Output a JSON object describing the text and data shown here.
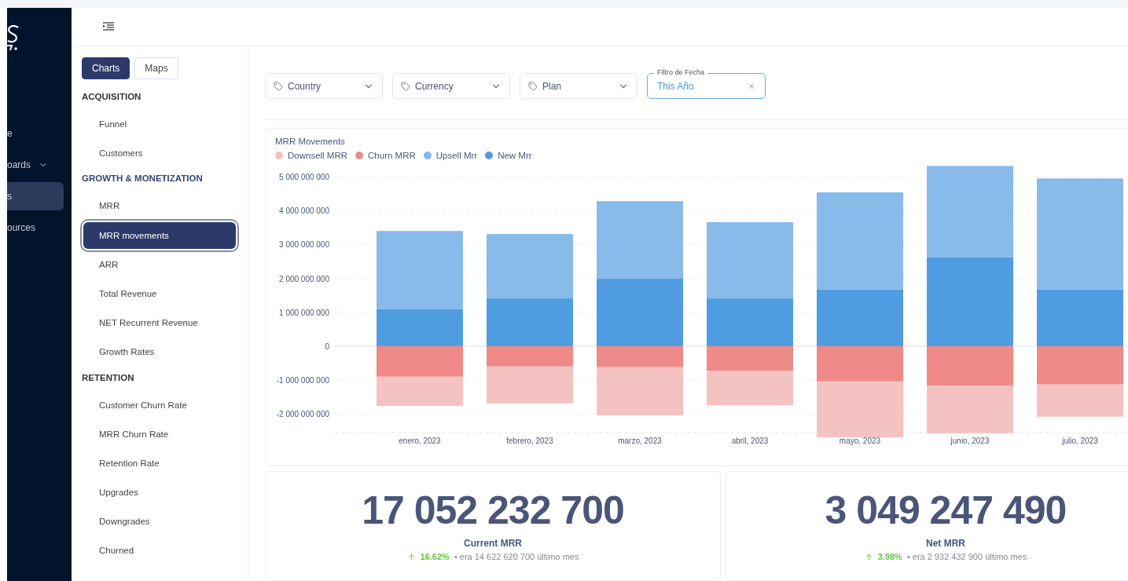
{
  "sidebar": {
    "items": [
      {
        "label": "e",
        "selected": false,
        "expandable": false
      },
      {
        "label": "oards",
        "selected": false,
        "expandable": true
      },
      {
        "label": "s",
        "selected": true,
        "expandable": false
      },
      {
        "label": "ources",
        "selected": false,
        "expandable": false
      }
    ]
  },
  "nav": {
    "tabs": [
      {
        "label": "Charts",
        "selected": true
      },
      {
        "label": "Maps",
        "selected": false
      }
    ],
    "sections": [
      {
        "title": "ACQUISITION",
        "active": false,
        "items": [
          {
            "label": "Funnel",
            "selected": false
          },
          {
            "label": "Customers",
            "selected": false
          }
        ]
      },
      {
        "title": "GROWTH & MONETIZATION",
        "active": true,
        "items": [
          {
            "label": "MRR",
            "selected": false
          },
          {
            "label": "MRR movements",
            "selected": true
          },
          {
            "label": "ARR",
            "selected": false
          },
          {
            "label": "Total Revenue",
            "selected": false
          },
          {
            "label": "NET Recurrent Revenue",
            "selected": false
          },
          {
            "label": "Growth Rates",
            "selected": false
          }
        ]
      },
      {
        "title": "RETENTION",
        "active": false,
        "items": [
          {
            "label": "Customer Churn Rate",
            "selected": false
          },
          {
            "label": "MRR Churn Rate",
            "selected": false
          },
          {
            "label": "Retention Rate",
            "selected": false
          },
          {
            "label": "Upgrades",
            "selected": false
          },
          {
            "label": "Downgrades",
            "selected": false
          },
          {
            "label": "Churned",
            "selected": false
          }
        ]
      }
    ]
  },
  "filters": [
    {
      "kind": "select",
      "label": "Country"
    },
    {
      "kind": "select",
      "label": "Currency"
    },
    {
      "kind": "select",
      "label": "Plan"
    },
    {
      "kind": "date",
      "legend": "Filtro de Fecha",
      "value": "This Año"
    }
  ],
  "chart": {
    "chart_data": {
      "type": "bar",
      "title": "MRR Movements",
      "stacked": true,
      "grid": true,
      "categories": [
        "enero, 2023",
        "febrero, 2023",
        "marzo, 2023",
        "abril, 2023",
        "mayo, 2023",
        "junio, 2023",
        "julio, 2023"
      ],
      "series": [
        {
          "name": "Downsell MRR",
          "color": "#f5c2c2",
          "values": [
            -860000000,
            -1090000000,
            -1420000000,
            -1020000000,
            -1650000000,
            -1410000000,
            -950000000
          ]
        },
        {
          "name": "Churn MRR",
          "color": "#ef8a88",
          "values": [
            -900000000,
            -600000000,
            -620000000,
            -720000000,
            -1040000000,
            -1160000000,
            -1130000000
          ]
        },
        {
          "name": "Upsell Mrr",
          "color": "#88baea",
          "values": [
            2310000000,
            1900000000,
            2290000000,
            2250000000,
            2870000000,
            2700000000,
            3280000000
          ]
        },
        {
          "name": "New Mrr",
          "color": "#4f9de0",
          "values": [
            1090000000,
            1410000000,
            1990000000,
            1410000000,
            1670000000,
            2620000000,
            1670000000
          ]
        }
      ],
      "ylim": [
        -2550000000,
        5350000000
      ],
      "yticks": [
        {
          "value": -2000000000,
          "label": "-2 000 000 000"
        },
        {
          "value": -1000000000,
          "label": "-1 000 000 000"
        },
        {
          "value": 0,
          "label": "0"
        },
        {
          "value": 1000000000,
          "label": "1 000 000 000"
        },
        {
          "value": 2000000000,
          "label": "2 000 000 000"
        },
        {
          "value": 3000000000,
          "label": "3 000 000 000"
        },
        {
          "value": 4000000000,
          "label": "4 000 000 000"
        },
        {
          "value": 5000000000,
          "label": "5 000 000 000"
        }
      ]
    }
  },
  "stats": [
    {
      "value": "17 052 232 700",
      "label": "Current MRR",
      "change": "16.62%",
      "comparison": "• era 14 622 620 700 último mes"
    },
    {
      "value": "3 049 247 490",
      "label": "Net MRR",
      "change": "3.98%",
      "comparison": "• era 2 932 432 900 último mes"
    }
  ]
}
